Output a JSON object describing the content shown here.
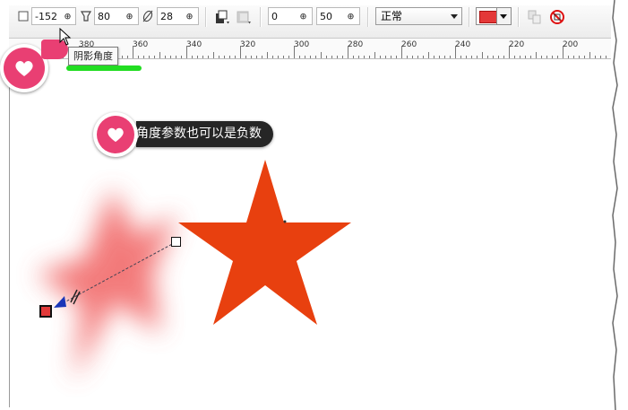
{
  "toolbar": {
    "shadow_angle": "-152",
    "shadow_stretch": "80",
    "shadow_feather": "28",
    "fade": "0",
    "opacity": "50",
    "merge_mode": "正常",
    "shadow_color": "#e43838",
    "spin_glyph": "⊕",
    "icons": [
      "shadow-angle-icon",
      "shadow-stretch-icon",
      "feather-icon",
      "shadow-direction-icon",
      "feather-edges-icon",
      "copy-shadow-icon",
      "clear-shadow-icon"
    ]
  },
  "ruler": {
    "labels": [
      "380",
      "360",
      "340",
      "320",
      "300",
      "280",
      "260",
      "240",
      "220",
      "200"
    ]
  },
  "tooltip": "阴影角度",
  "callout": "角度参数也可以是负数",
  "colors": {
    "star": "#e8400f",
    "shadow": "#f05a5a",
    "badge": "#e93f73",
    "highlight": "#22dd22",
    "callout_bg": "#262626"
  }
}
